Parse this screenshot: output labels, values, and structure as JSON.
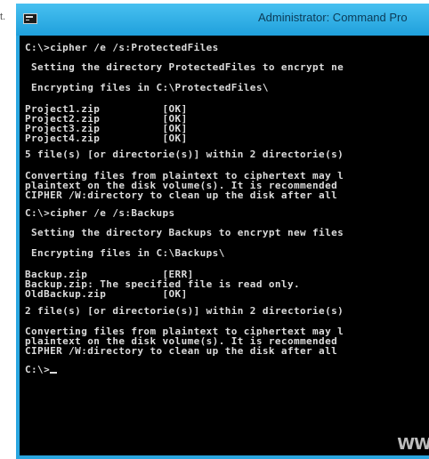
{
  "stray_text": "t.",
  "window": {
    "title": "Administrator: Command Pro",
    "icon": "cmd-icon"
  },
  "console": {
    "lines": [
      "C:\\>cipher /e /s:ProtectedFiles",
      " Setting the directory ProtectedFiles to encrypt ne",
      " Encrypting files in C:\\ProtectedFiles\\",
      "Project1.zip          [OK]",
      "Project2.zip          [OK]",
      "Project3.zip          [OK]",
      "Project4.zip          [OK]",
      "5 file(s) [or directorie(s)] within 2 directorie(s)",
      "Converting files from plaintext to ciphertext may l",
      "plaintext on the disk volume(s). It is recommended",
      "CIPHER /W:directory to clean up the disk after all",
      "C:\\>cipher /e /s:Backups",
      " Setting the directory Backups to encrypt new files",
      " Encrypting files in C:\\Backups\\",
      "Backup.zip            [ERR]",
      "Backup.zip: The specified file is read only.",
      "OldBackup.zip         [OK]",
      "2 file(s) [or directorie(s)] within 2 directorie(s)",
      "Converting files from plaintext to ciphertext may l",
      "plaintext on the disk volume(s). It is recommended",
      "CIPHER /W:directory to clean up the disk after all",
      "C:\\>"
    ]
  },
  "watermark": "WW"
}
